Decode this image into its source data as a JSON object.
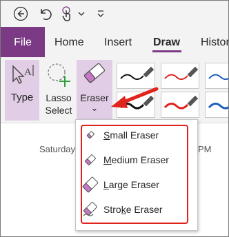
{
  "quick_access": {
    "icons": [
      "back-icon",
      "undo-icon",
      "touch-mode-icon",
      "chevron-down-icon",
      "customize-qat-icon"
    ]
  },
  "tabs": [
    {
      "label": "File"
    },
    {
      "label": "Home"
    },
    {
      "label": "Insert"
    },
    {
      "label": "Draw"
    },
    {
      "label": "Histor"
    }
  ],
  "active_tab": "Draw",
  "ribbon": {
    "type_label": "Type",
    "lasso_line1": "Lasso",
    "lasso_line2": "Select",
    "eraser_label": "Eraser",
    "eraser_chevron": "⌄"
  },
  "pens": [
    {
      "color": "#111111",
      "row": 1
    },
    {
      "color": "#e0231c",
      "row": 1
    },
    {
      "color": "#1f5fbf",
      "row": 1
    },
    {
      "color": "#111111",
      "row": 2
    },
    {
      "color": "#e0231c",
      "row": 2
    },
    {
      "color": "#1f5fbf",
      "row": 2
    }
  ],
  "page": {
    "date_left": "Saturday",
    "date_right": "PM"
  },
  "eraser_menu": {
    "items": [
      {
        "pre": "",
        "key": "S",
        "post": "mall Eraser",
        "icon": "small-eraser-icon"
      },
      {
        "pre": "",
        "key": "M",
        "post": "edium Eraser",
        "icon": "medium-eraser-icon"
      },
      {
        "pre": "",
        "key": "L",
        "post": "arge Eraser",
        "icon": "large-eraser-icon"
      },
      {
        "pre": "Stro",
        "key": "k",
        "post": "e Eraser",
        "icon": "stroke-eraser-icon"
      }
    ]
  },
  "colors": {
    "accent": "#7b3a83",
    "highlight": "#e0231c",
    "selected_bg": "#e2cde6"
  }
}
